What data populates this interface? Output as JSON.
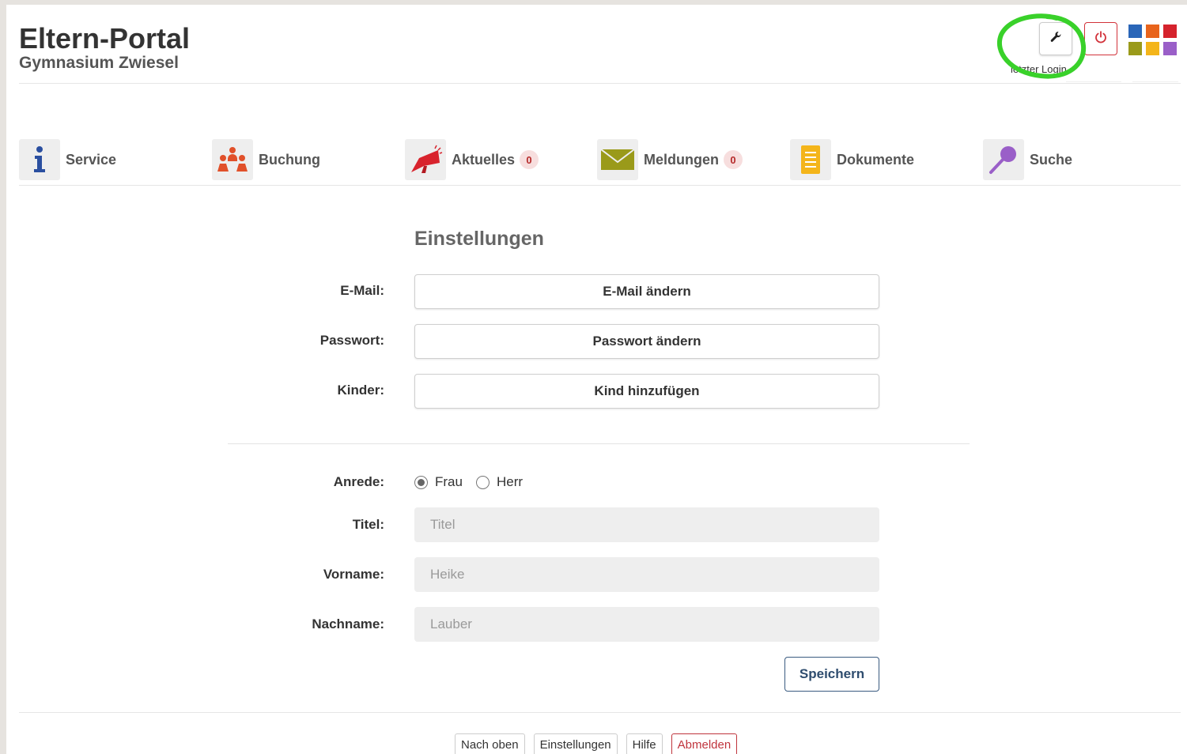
{
  "header": {
    "title": "Eltern-Portal",
    "school": "Gymnasium Zwiesel",
    "last_login_label": "letzter Login",
    "settings_icon": "wrench-icon",
    "logout_icon": "power-icon",
    "apps_icon": "app-grid-icon",
    "annotation_color": "#39d12a"
  },
  "nav": {
    "items": [
      {
        "label": "Service",
        "icon": "info-icon"
      },
      {
        "label": "Buchung",
        "icon": "people-icon"
      },
      {
        "label": "Aktuelles",
        "icon": "megaphone-icon",
        "badge": "0"
      },
      {
        "label": "Meldungen",
        "icon": "envelope-icon",
        "badge": "0"
      },
      {
        "label": "Dokumente",
        "icon": "document-icon"
      },
      {
        "label": "Suche",
        "icon": "magnifier-icon"
      }
    ]
  },
  "settings": {
    "title": "Einstellungen",
    "email_label": "E-Mail:",
    "email_button": "E-Mail ändern",
    "password_label": "Passwort:",
    "password_button": "Passwort ändern",
    "children_label": "Kinder:",
    "children_button": "Kind hinzufügen",
    "salutation_label": "Anrede:",
    "salutation_options": [
      {
        "label": "Frau",
        "selected": true
      },
      {
        "label": "Herr",
        "selected": false
      }
    ],
    "title_label": "Titel:",
    "title_placeholder": "Titel",
    "firstname_label": "Vorname:",
    "firstname_placeholder": "Heike",
    "lastname_label": "Nachname:",
    "lastname_placeholder": "Lauber",
    "save_button": "Speichern"
  },
  "footer": {
    "top": "Nach oben",
    "settings": "Einstellungen",
    "help": "Hilfe",
    "logout": "Abmelden"
  },
  "colors": {
    "app_grid": [
      "#2a66b8",
      "#e8641c",
      "#d5232d",
      "#9a9a1a",
      "#f4b51a",
      "#9a5fc8"
    ],
    "accent": "#2e4c6e",
    "danger": "#c0353d"
  }
}
